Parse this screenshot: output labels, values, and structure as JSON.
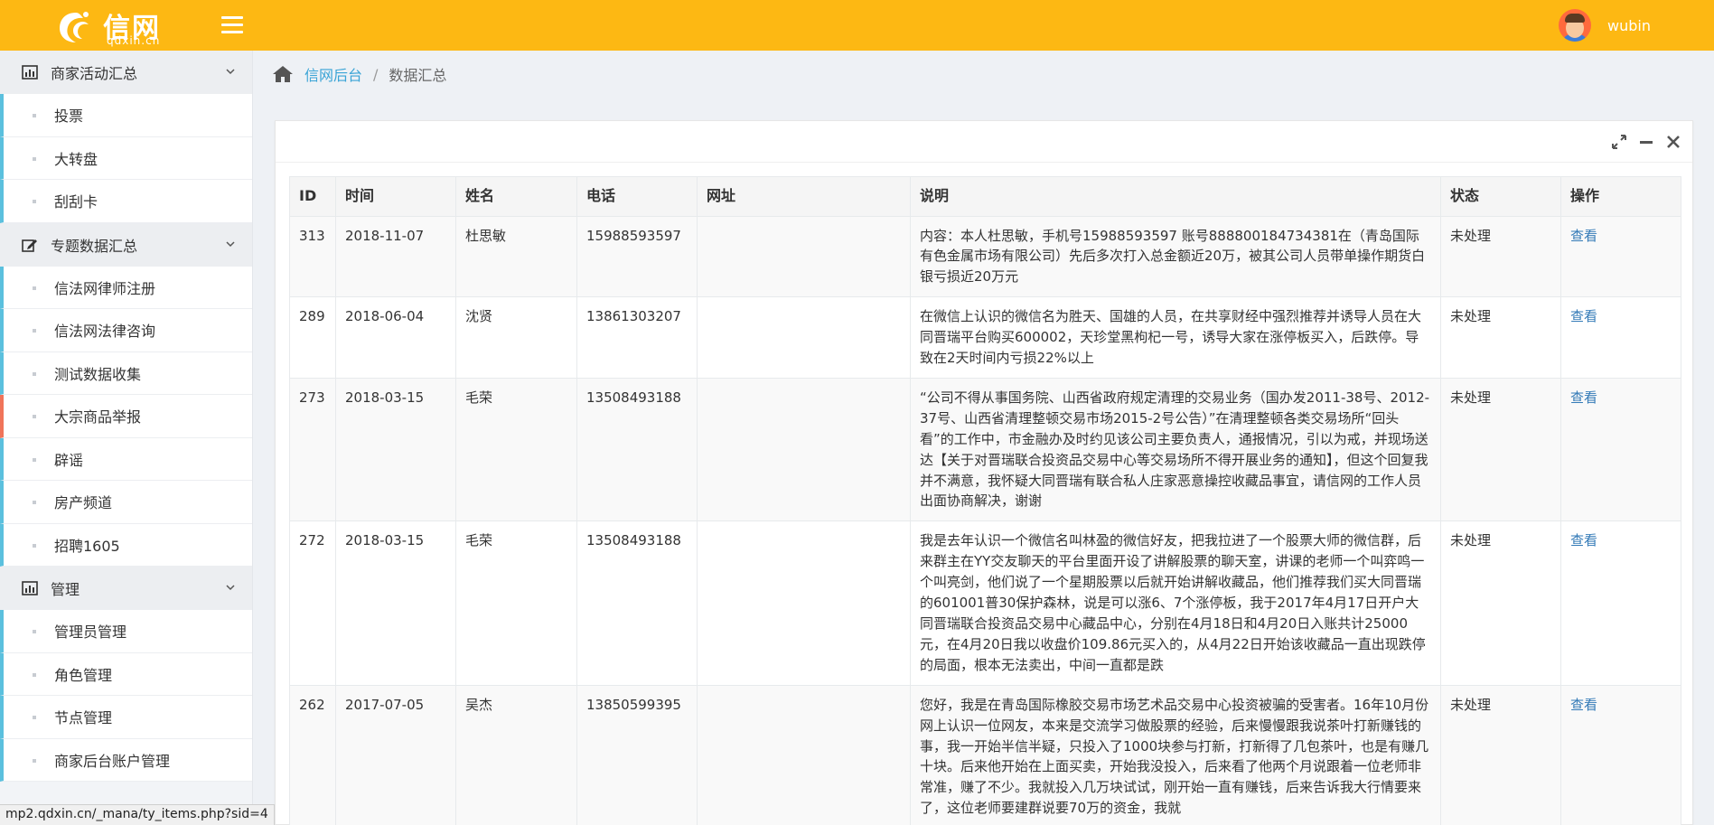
{
  "header": {
    "brand": "信网",
    "domain": "qdxin.cn",
    "username": "wubin"
  },
  "sidebar": {
    "groups": [
      {
        "label": "商家活动汇总",
        "icon": "bar-chart-icon",
        "items": [
          "投票",
          "大转盘",
          "刮刮卡"
        ]
      },
      {
        "label": "专题数据汇总",
        "icon": "edit-icon",
        "items": [
          "信法网律师注册",
          "信法网法律咨询",
          "测试数据收集",
          "大宗商品举报",
          "辟谣",
          "房产频道",
          "招聘1605"
        ]
      },
      {
        "label": "管理",
        "icon": "bar-chart-icon",
        "items": [
          "管理员管理",
          "角色管理",
          "节点管理",
          "商家后台账户管理"
        ]
      }
    ],
    "active_item": "大宗商品举报"
  },
  "breadcrumb": {
    "root": "信网后台",
    "separator": "/",
    "current": "数据汇总"
  },
  "table": {
    "headers": [
      "ID",
      "时间",
      "姓名",
      "电话",
      "网址",
      "说明",
      "状态",
      "操作"
    ],
    "rows": [
      {
        "id": "313",
        "time": "2018-11-07",
        "name": "杜思敏",
        "phone": "15988593597",
        "url": "",
        "desc": "内容：本人杜思敏，手机号15988593597 账号888800184734381在（青岛国际有色金属市场有限公司）先后多次打入总金额近20万，被其公司人员带单操作期货白银亏损近20万元",
        "status": "未处理",
        "action": "查看"
      },
      {
        "id": "289",
        "time": "2018-06-04",
        "name": "沈贤",
        "phone": "13861303207",
        "url": "",
        "desc": "在微信上认识的微信名为胜天、国雄的人员，在共享财经中强烈推荐并诱导人员在大同晋瑞平台购买600002，天珍堂黑枸杞一号，诱导大家在涨停板买入，后跌停。导致在2天时间内亏损22%以上",
        "status": "未处理",
        "action": "查看"
      },
      {
        "id": "273",
        "time": "2018-03-15",
        "name": "毛荣",
        "phone": "13508493188",
        "url": "",
        "desc": "“公司不得从事国务院、山西省政府规定清理的交易业务（国办发2011-38号、2012-37号、山西省清理整顿交易市场2015-2号公告）”在清理整顿各类交易场所“回头看”的工作中，市金融办及时约见该公司主要负责人，通报情况，引以为戒，并现场送达【关于对晋瑞联合投资品交易中心等交易场所不得开展业务的通知】，但这个回复我并不满意，我怀疑大同晋瑞有联合私人庄家恶意操控收藏品事宜，请信网的工作人员出面协商解决，谢谢",
        "status": "未处理",
        "action": "查看"
      },
      {
        "id": "272",
        "time": "2018-03-15",
        "name": "毛荣",
        "phone": "13508493188",
        "url": "",
        "desc": "我是去年认识一个微信名叫林盈的微信好友，把我拉进了一个股票大师的微信群，后来群主在YY交友聊天的平台里面开设了讲解股票的聊天室，讲课的老师一个叫弈鸣一个叫亮剑，他们说了一个星期股票以后就开始讲解收藏品，他们推荐我们买大同晋瑞的601001普30保护森林，说是可以涨6、7个涨停板，我于2017年4月17日开户大同晋瑞联合投资品交易中心藏品中心，分别在4月18日和4月20日入账共计25000元，在4月20日我以收盘价109.86元买入的，从4月22日开始该收藏品一直出现跌停的局面，根本无法卖出，中间一直都是跌",
        "status": "未处理",
        "action": "查看"
      },
      {
        "id": "262",
        "time": "2017-07-05",
        "name": "吴杰",
        "phone": "13850599395",
        "url": "",
        "desc": "您好，我是在青岛国际橡胶交易市场艺术品交易中心投资被骗的受害者。16年10月份网上认识一位网友，本来是交流学习做股票的经验，后来慢慢跟我说茶叶打新赚钱的事，我一开始半信半疑，只投入了1000块参与打新，打新得了几包茶叶，也是有赚几十块。后来他开始在上面买卖，开始我没投入，后来看了他两个月说跟着一位老师非常准，赚了不少。我就投入几万块试试，刚开始一直有赚钱，后来告诉我大行情要来了，这位老师要建群说要70万的资金，我就",
        "status": "未处理",
        "action": "查看"
      }
    ]
  },
  "status_url": "mp2.qdxin.cn/_mana/ty_items.php?sid=4"
}
